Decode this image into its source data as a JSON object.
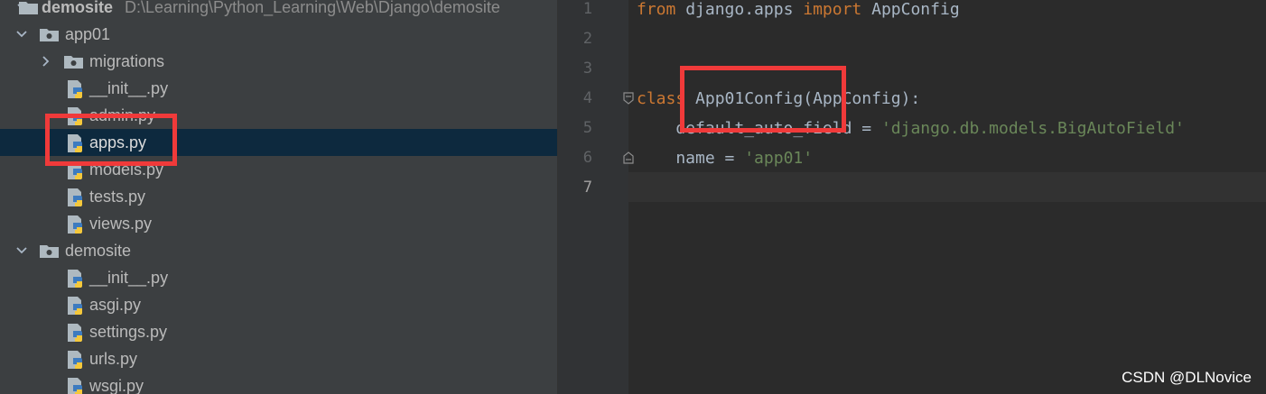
{
  "project_tree": {
    "root_name": "demosite",
    "root_path": "D:\\Learning\\Python_Learning\\Web\\Django\\demosite",
    "items": [
      {
        "label": "app01",
        "kind": "folder"
      },
      {
        "label": "migrations",
        "kind": "folder"
      },
      {
        "label": "__init__.py",
        "kind": "python-file"
      },
      {
        "label": "admin.py",
        "kind": "python-file"
      },
      {
        "label": "apps.py",
        "kind": "python-file",
        "selected": true
      },
      {
        "label": "models.py",
        "kind": "python-file"
      },
      {
        "label": "tests.py",
        "kind": "python-file"
      },
      {
        "label": "views.py",
        "kind": "python-file"
      },
      {
        "label": "demosite",
        "kind": "folder"
      },
      {
        "label": "__init__.py",
        "kind": "python-file"
      },
      {
        "label": "asgi.py",
        "kind": "python-file"
      },
      {
        "label": "settings.py",
        "kind": "python-file"
      },
      {
        "label": "urls.py",
        "kind": "python-file"
      },
      {
        "label": "wsgi.py",
        "kind": "python-file"
      }
    ]
  },
  "editor": {
    "line_numbers": [
      "1",
      "2",
      "3",
      "4",
      "5",
      "6",
      "7"
    ],
    "current_line": "7",
    "lines": [
      {
        "kw1": "from",
        "t1": " django.apps ",
        "kw2": "import",
        "t2": " AppConfig"
      },
      {},
      {},
      {
        "kw1": "class",
        "t1": " App01Config(AppConfig):"
      },
      {
        "t1": "    default_auto_field = ",
        "s1": "'django.db.models.BigAutoField'"
      },
      {
        "t1": "    name = ",
        "s1": "'app01'"
      },
      {}
    ]
  },
  "annotation_color": "#f03a3a",
  "watermark": "CSDN @DLNovice"
}
